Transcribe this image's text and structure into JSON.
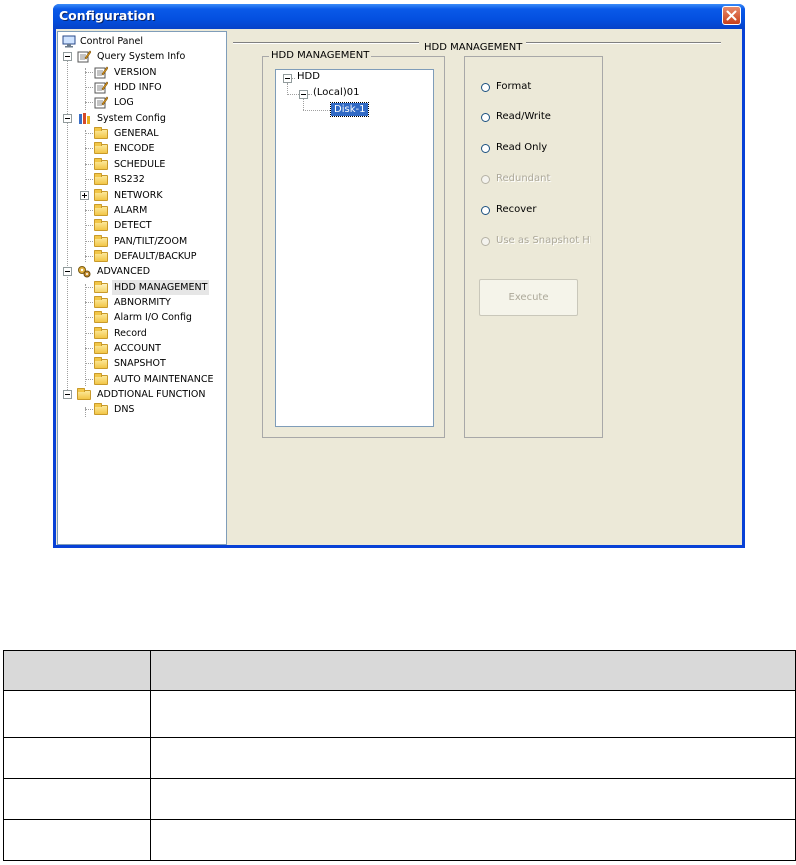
{
  "window": {
    "title": "Configuration",
    "close_icon": "close-icon"
  },
  "tree": {
    "items": [
      {
        "label": "Control Panel",
        "icon": "monitor-icon",
        "level": 0
      },
      {
        "label": "Query System Info",
        "icon": "notepad-icon",
        "level": 1,
        "expander": "minus"
      },
      {
        "label": "VERSION",
        "icon": "notepad-icon",
        "level": 2
      },
      {
        "label": "HDD INFO",
        "icon": "notepad-icon",
        "level": 2
      },
      {
        "label": "LOG",
        "icon": "notepad-icon",
        "level": 2
      },
      {
        "label": "System Config",
        "icon": "tools-icon",
        "level": 1,
        "expander": "minus"
      },
      {
        "label": "GENERAL",
        "icon": "folder-icon",
        "level": 2
      },
      {
        "label": "ENCODE",
        "icon": "folder-icon",
        "level": 2
      },
      {
        "label": "SCHEDULE",
        "icon": "folder-icon",
        "level": 2
      },
      {
        "label": "RS232",
        "icon": "folder-icon",
        "level": 2
      },
      {
        "label": "NETWORK",
        "icon": "folder-icon",
        "level": 2,
        "expander": "plus"
      },
      {
        "label": "ALARM",
        "icon": "folder-icon",
        "level": 2
      },
      {
        "label": "DETECT",
        "icon": "folder-icon",
        "level": 2
      },
      {
        "label": "PAN/TILT/ZOOM",
        "icon": "folder-icon",
        "level": 2
      },
      {
        "label": "DEFAULT/BACKUP",
        "icon": "folder-icon",
        "level": 2
      },
      {
        "label": "ADVANCED",
        "icon": "gears-icon",
        "level": 1,
        "expander": "minus"
      },
      {
        "label": "HDD MANAGEMENT",
        "icon": "folder-open-icon",
        "level": 2,
        "selected": true
      },
      {
        "label": "ABNORMITY",
        "icon": "folder-icon",
        "level": 2
      },
      {
        "label": "Alarm I/O Config",
        "icon": "folder-icon",
        "level": 2
      },
      {
        "label": "Record",
        "icon": "folder-icon",
        "level": 2
      },
      {
        "label": "ACCOUNT",
        "icon": "folder-icon",
        "level": 2
      },
      {
        "label": "SNAPSHOT",
        "icon": "folder-icon",
        "level": 2
      },
      {
        "label": "AUTO MAINTENANCE",
        "icon": "folder-icon",
        "level": 2
      },
      {
        "label": "ADDTIONAL FUNCTION",
        "icon": "folder-icon",
        "level": 1,
        "expander": "minus"
      },
      {
        "label": "DNS",
        "icon": "folder-icon",
        "level": 2
      }
    ]
  },
  "main": {
    "section_title": "HDD MANAGEMENT",
    "group_title": "HDD MANAGEMENT",
    "hdd_tree": {
      "root": "HDD",
      "node": "(Local)01",
      "disk": "Disk-1"
    },
    "options": [
      {
        "label": "Format",
        "enabled": true
      },
      {
        "label": "Read/Write",
        "enabled": true
      },
      {
        "label": "Read Only",
        "enabled": true
      },
      {
        "label": "Redundant",
        "enabled": false
      },
      {
        "label": "Recover",
        "enabled": true
      },
      {
        "label": "Use as Snapshot HD",
        "enabled": false
      }
    ],
    "execute_label": "Execute"
  },
  "colors": {
    "titlebar": "#0a5ae8",
    "client_bg": "#ece9d8",
    "selection": "#316ac5"
  }
}
